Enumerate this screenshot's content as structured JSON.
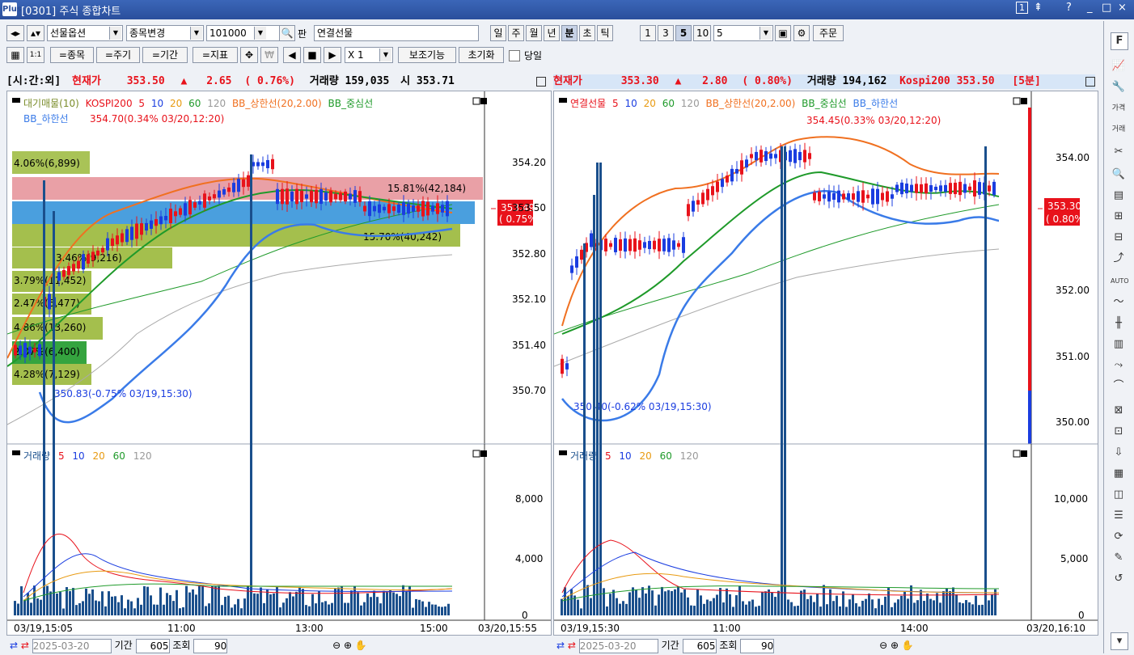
{
  "window": {
    "title": "[0301] 주식 종합차트",
    "logo": "Plus",
    "controls": [
      "1",
      "?",
      "_",
      "□",
      "×"
    ]
  },
  "toolbar1": {
    "nav": [
      "◂▸",
      "▴▾"
    ],
    "category": "선물옵션",
    "change": "종목변경",
    "code": "101000",
    "pan": "판",
    "name": "연결선물",
    "periods": [
      "일",
      "주",
      "월",
      "년",
      "분",
      "초",
      "틱"
    ],
    "active_period": "분",
    "minutes": [
      "1",
      "3",
      "5",
      "10"
    ],
    "active_minute": "5",
    "custom_minute": "5",
    "order": "주문"
  },
  "toolbar2": {
    "item": "=종목",
    "cycle": "=주기",
    "span": "=기간",
    "indicator": "=지표",
    "multiplier": "X 1",
    "aux": "보조기능",
    "reset": "초기화",
    "today_label": "당일"
  },
  "left_head": {
    "tag": "[시:간:외]",
    "price_label": "현재가",
    "price": "353.50",
    "arrow": "▲",
    "change": "2.65",
    "pct": "( 0.76%)",
    "vol_label": "거래량",
    "volume": "159,035",
    "open_label": "시",
    "open": "353.71"
  },
  "right_head": {
    "price_label": "현재가",
    "price": "353.30",
    "arrow": "▲",
    "change": "2.80",
    "pct": "( 0.80%)",
    "vol_label": "거래량",
    "volume": "194,162",
    "idx_label": "Kospi200",
    "idx": "353.50",
    "cycle": "[5분]"
  },
  "left_chart": {
    "legend1": [
      "대기매물(10)",
      "KOSPI200",
      "5",
      "10",
      "20",
      "60",
      "120",
      "BB_상한선(20,2.00)",
      "BB_중심선"
    ],
    "legend2": [
      "BB_하한선"
    ],
    "high_note": "354.70(0.34% 03/20,12:20)",
    "low_note": "350.83(-0.75% 03/19,15:30)",
    "yticks": [
      "354.20",
      "353.50",
      "352.80",
      "352.10",
      "351.40",
      "350.70"
    ],
    "price_tag": [
      "353.49",
      "( 0.75%)"
    ],
    "profile": [
      "4.06%(6,899)",
      "15.81%(42,184)",
      "15.70%(40,242)",
      "3.46%(9,216)",
      "3.79%(11,452)",
      "2.47%(6,477)",
      "4.86%(13,260)",
      "2.37%(6,400)",
      "4.28%(7,129)"
    ]
  },
  "right_chart": {
    "legend1": [
      "연결선물",
      "5",
      "10",
      "20",
      "60",
      "120",
      "BB_상한선(20,2.00)",
      "BB_중심선",
      "BB_하한선"
    ],
    "high_note": "354.45(0.33% 03/20,12:20)",
    "low_note": "350.40(-0.62% 03/19,15:30)",
    "yticks": [
      "354.00",
      "352.00",
      "351.00",
      "350.00"
    ],
    "price_tag": [
      "353.30",
      "( 0.80%)"
    ]
  },
  "left_volume": {
    "legend": [
      "거래량",
      "5",
      "10",
      "20",
      "60",
      "120"
    ],
    "yticks": [
      "8,000",
      "4,000",
      "0"
    ],
    "xticks": [
      "03/19,15:05",
      "11:00",
      "13:00",
      "15:00",
      "03/20,15:55"
    ]
  },
  "right_volume": {
    "legend": [
      "거래량",
      "5",
      "10",
      "20",
      "60",
      "120"
    ],
    "yticks": [
      "10,000",
      "5,000",
      "0"
    ],
    "xticks": [
      "03/19,15:30",
      "11:00",
      "14:00",
      "03/20,16:10"
    ]
  },
  "bottom_left": {
    "date": "2025-03-20",
    "span_label": "기간",
    "count": "605",
    "query": "조회",
    "zoom": "90"
  },
  "bottom_right": {
    "date": "2025-03-20",
    "span_label": "기간",
    "count": "605",
    "query": "조회",
    "zoom": "90"
  },
  "sidebar": {
    "top": "F",
    "icons": [
      "가격",
      "거래",
      "AUTO"
    ]
  },
  "colors": {
    "up": "#e8121b",
    "down": "#1a3de0",
    "bb_upper": "#f07020",
    "bb_mid": "#1f9a2a",
    "bb_lower": "#3a7be8",
    "ma120": "#aaaaaa",
    "vol": "#1a4f8c"
  }
}
